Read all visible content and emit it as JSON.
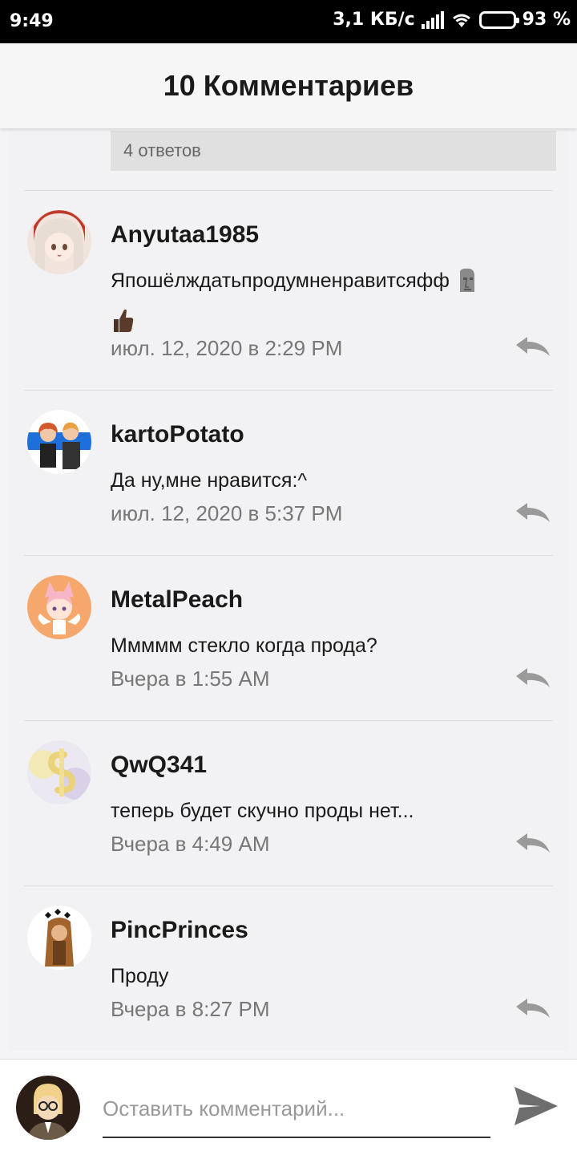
{
  "status_bar": {
    "time": "9:49",
    "network_speed": "3,1 КБ/с",
    "battery": "93 %",
    "battery_level": 0.93,
    "battery_color": "#f4a340"
  },
  "header": {
    "title": "10 Комментариев"
  },
  "thread": {
    "replies_label": "4 ответов"
  },
  "comments": [
    {
      "author": "Anyutaa1985",
      "text": "Япошёлждатьпродумненравитсяфф",
      "emojis": [
        "moai-emoji",
        "thumbs-up-emoji"
      ],
      "date": "июл. 12, 2020 в 2:29 PM"
    },
    {
      "author": "kartoPotato",
      "text": "Да ну,мне нравится:^",
      "date": "июл. 12, 2020 в 5:37 PM"
    },
    {
      "author": "MetalPeach",
      "text": "Ммммм стекло когда прода?",
      "date": "Вчера в 1:55 AM"
    },
    {
      "author": "QwQ341",
      "text": "теперь будет скучно проды нет...",
      "date": "Вчера в 4:49 AM"
    },
    {
      "author": "PincPrinces",
      "text": "Проду",
      "date": "Вчера в 8:27 PM"
    }
  ],
  "composer": {
    "placeholder": "Оставить комментарий...",
    "value": ""
  },
  "icons": {
    "reply": "reply-arrow-icon",
    "send": "send-icon"
  }
}
